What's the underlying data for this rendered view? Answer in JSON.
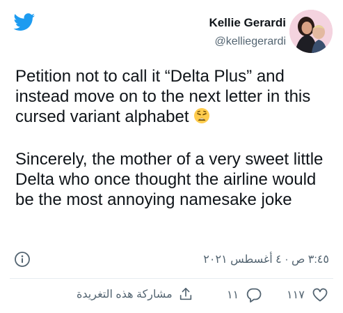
{
  "author": {
    "name": "Kellie Gerardi",
    "handle": "@kelliegerardi"
  },
  "tweet": {
    "paragraph1": "Petition not to call it “Delta Plus” and instead move on to the next letter in this cursed variant alphabet",
    "paragraph2": "Sincerely, the mother of a very sweet little Delta who once thought the airline would be the most annoying namesake joke",
    "emoji": "weary-face-emoji"
  },
  "meta": {
    "timestamp": "٣:٤٥ ص · ٤ أغسطس ٢٠٢١"
  },
  "actions": {
    "share_label": "مشاركة هذه التغريدة",
    "reply_count": "١١",
    "like_count": "١١٧"
  },
  "colors": {
    "twitter_blue": "#1d9bf0",
    "secondary_text": "#536471",
    "primary_text": "#0f1419"
  }
}
